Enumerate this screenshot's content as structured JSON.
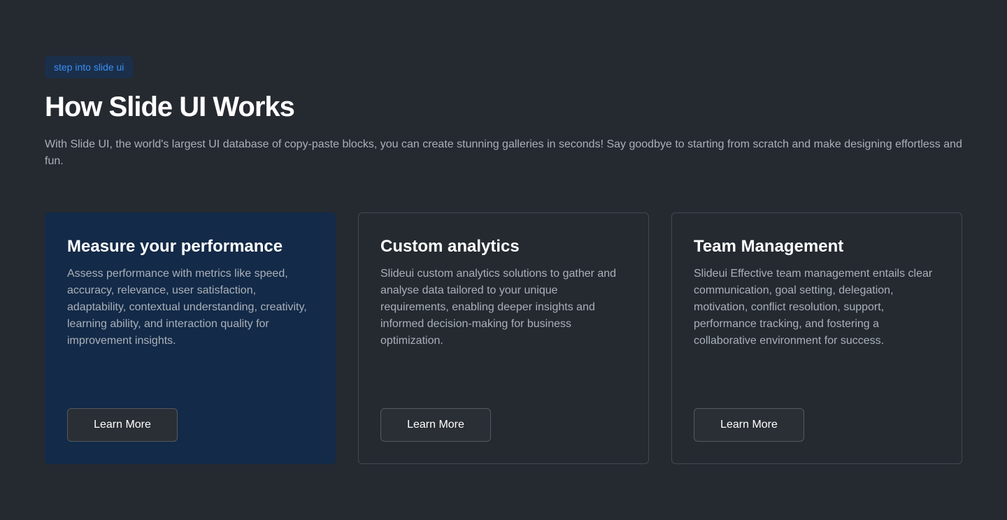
{
  "hero": {
    "badge": "step into slide ui",
    "title": "How Slide UI Works",
    "description": "With Slide UI, the world's largest UI database of copy-paste blocks, you can create stunning galleries in seconds! Say goodbye to starting from scratch and make designing effortless and fun."
  },
  "cards": [
    {
      "title": "Measure your performance",
      "text": "Assess performance with metrics like speed, accuracy, relevance, user satisfaction, adaptability, contextual understanding, creativity, learning ability, and interaction quality for improvement insights.",
      "button": "Learn More"
    },
    {
      "title": "Custom analytics",
      "text": "Slideui custom analytics solutions to gather and analyse data tailored to your unique requirements, enabling deeper insights and informed decision-making for business optimization.",
      "button": "Learn More"
    },
    {
      "title": "Team Management",
      "text": "Slideui Effective team management entails clear communication, goal setting, delegation, motivation, conflict resolution, support, performance tracking, and fostering a collaborative environment for success.",
      "button": "Learn More"
    }
  ],
  "colors": {
    "background": "#252a31",
    "accent": "#3b8ff0",
    "badge_background": "#1b2f4b",
    "featured_card": "#132a48"
  }
}
